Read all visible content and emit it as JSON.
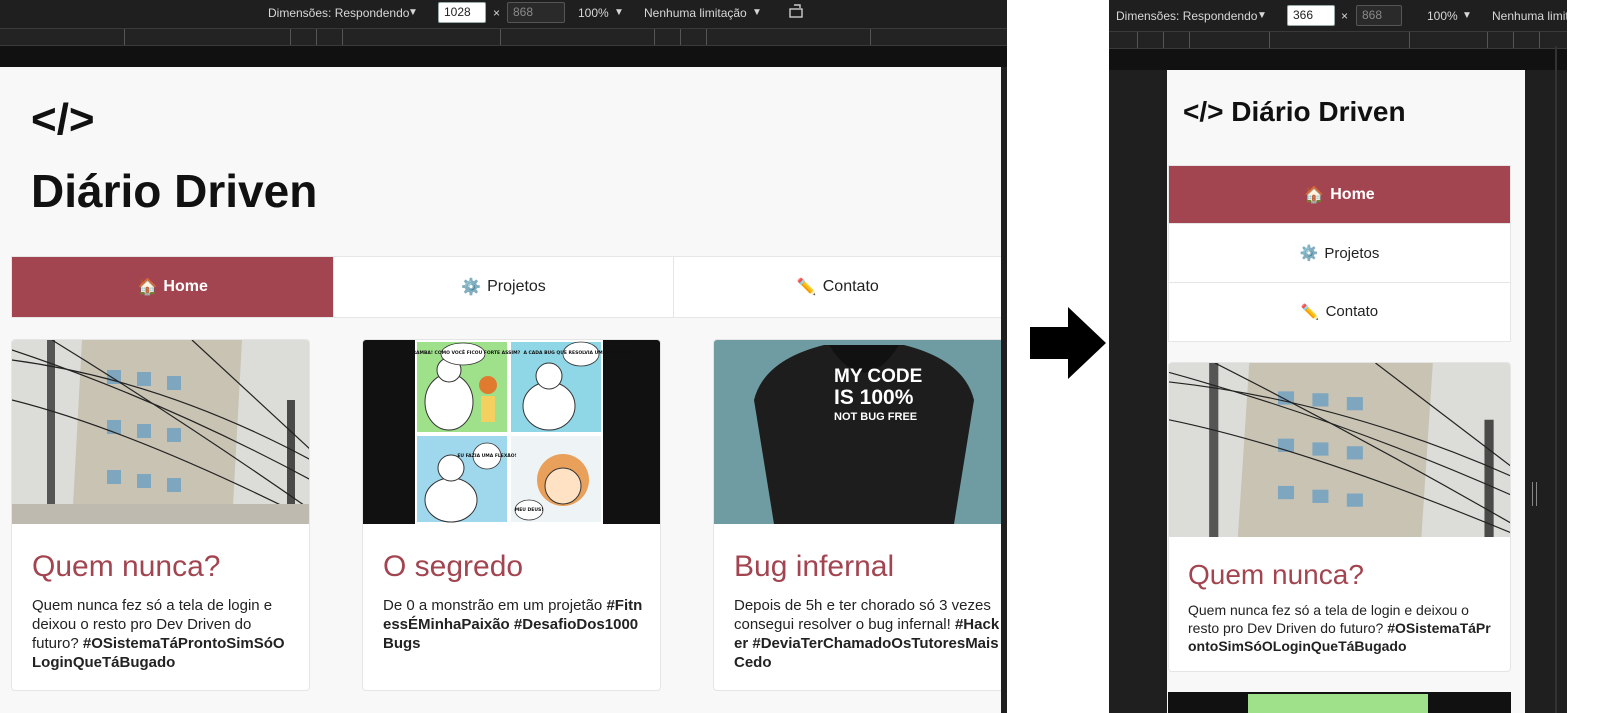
{
  "devtools": {
    "dims_label": "Dimensões: Respondendo",
    "zoom": "100%",
    "throttle": "Nenhuma limitação",
    "throttle_cut": "Nenhuma limitaç",
    "times": "×",
    "left": {
      "width": "1028",
      "height": "868"
    },
    "right": {
      "width": "366",
      "height": "868"
    }
  },
  "site": {
    "logo": "</>",
    "title": "Diário Driven",
    "nav": [
      {
        "icon": "🏠",
        "label": "Home"
      },
      {
        "icon": "⚙️",
        "label": "Projetos"
      },
      {
        "icon": "✏️",
        "label": "Contato"
      }
    ]
  },
  "cards": [
    {
      "title": "Quem nunca?",
      "text": "Quem nunca fez só a tela de login e deixou o resto pro Dev Driven do futuro?",
      "tags": "#OSistemaTáProntoSimSóOLoginQueTáBugado"
    },
    {
      "title": "O segredo",
      "text": "De 0 a monstrão em um projetão",
      "tags": "#FitnessÉMinhaPaixão #DesafioDos1000Bugs"
    },
    {
      "title": "Bug infernal",
      "text": "Depois de 5h e ter chorado só 3 vezes consegui resolver o bug infernal!",
      "tags": "#Hacker #DeviaTerChamadoOsTutoresMaisCedo"
    }
  ],
  "comic": {
    "b1": "CARAMBA! COMO VOCÊ FICOU FORTE ASSIM?",
    "b2": "A CADA BUG QUE RESOLVIA UM NO CÓDIGO...",
    "b3": "EU FAZIA UMA FLEXÃO!",
    "b4": "MEU DEUS!"
  },
  "hoodie": {
    "l1": "MY CODE",
    "l2": "IS 100%",
    "l3": "NOT BUG FREE"
  },
  "colors": {
    "accent": "#a34550",
    "devtools_bg": "#1f1f1f"
  }
}
